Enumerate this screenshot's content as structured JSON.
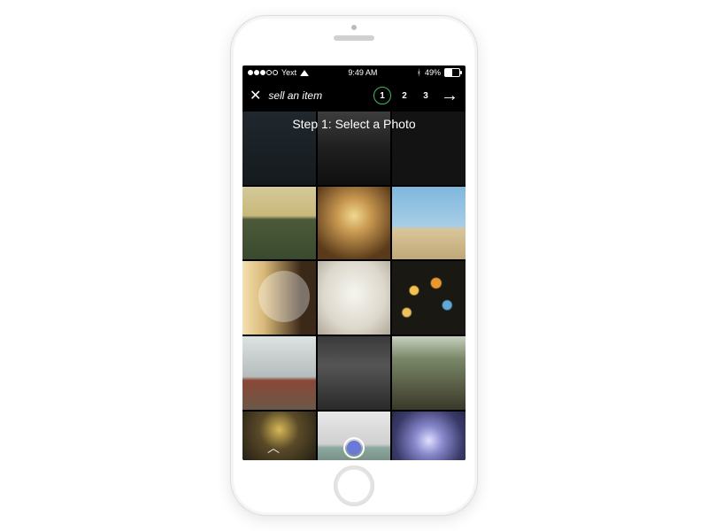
{
  "status": {
    "carrier": "Yext",
    "time": "9:49 AM",
    "battery_pct": "49%"
  },
  "header": {
    "title": "sell an item",
    "steps": [
      "1",
      "2",
      "3"
    ],
    "active_step": 0
  },
  "subtitle": "Step 1: Select a Photo",
  "thumbs": [
    {
      "name": "sky"
    },
    {
      "name": "city"
    },
    {
      "name": "dark1"
    },
    {
      "name": "rocks"
    },
    {
      "name": "rails"
    },
    {
      "name": "beach"
    },
    {
      "name": "curtain"
    },
    {
      "name": "laptop"
    },
    {
      "name": "bokeh"
    },
    {
      "name": "trike"
    },
    {
      "name": "road"
    },
    {
      "name": "forest"
    },
    {
      "name": "night"
    },
    {
      "name": "van"
    },
    {
      "name": "concert"
    }
  ]
}
